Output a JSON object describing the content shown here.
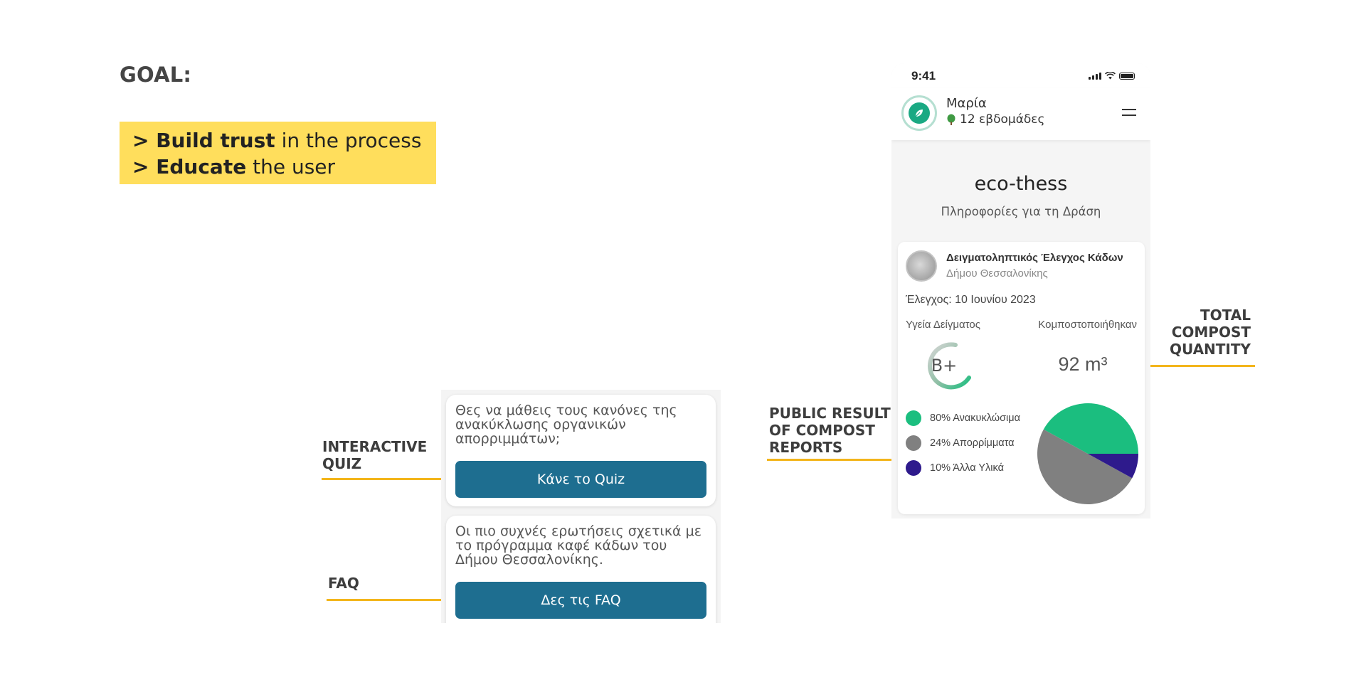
{
  "slide": {
    "goal_title": "GOAL:",
    "goal_lines": [
      {
        "prefix": "> ",
        "bold": "Build trust",
        "rest": " in the process"
      },
      {
        "prefix": "> ",
        "bold": "Educate",
        "rest": " the user"
      }
    ],
    "annotations": {
      "interactive_quiz": "INTERACTIVE\nQUIZ",
      "faq": "FAQ",
      "public_results": "PUBLIC RESULTS\nOF COMPOST\nREPORTS",
      "total_compost": "TOTAL\nCOMPOST\nQUANTITY"
    },
    "accent_color": "#FFDE5C",
    "arrow_color": "#F3B51B"
  },
  "cards": {
    "quiz_text": "Θες να μάθεις τους κανόνες της ανακύκλωσης οργανικών απορριμμάτων;",
    "quiz_button": "Κάνε το Quiz",
    "faq_text": "Οι πιο συχνές ερωτήσεις σχετικά με το πρόγραμμα καφέ κάδων του Δήμου Θεσσαλονίκης.",
    "faq_button": "Δες τις FAQ",
    "button_color": "#1E6E90"
  },
  "phone": {
    "status_time": "9:41",
    "user": {
      "name": "Μαρία",
      "weeks": "12 εβδομάδες",
      "avatar_icon": "leaf-icon",
      "weeks_icon": "tree-icon"
    },
    "menu_icon": "hamburger-menu-icon",
    "app_title": "eco-thess",
    "app_subtitle": "Πληροφορίες για τη Δράση",
    "report": {
      "title": "Δειγματοληπτικός Έλεγχος Κάδων",
      "org": "Δήμου Θεσσαλονίκης",
      "date": "Έλεγχος: 10 Ιουνίου 2023",
      "health_label": "Υγεία Δείγματος",
      "grade": "B+",
      "compost_label": "Κομποστοποιήθηκαν",
      "quantity": "92 m³",
      "legend": [
        {
          "label": "80% Ανακυκλώσιμα",
          "color": "#1BBE7F"
        },
        {
          "label": "24% Απορρίμματα",
          "color": "#808080"
        },
        {
          "label": "10% Άλλα Υλικά",
          "color": "#2E1A8C"
        }
      ]
    }
  },
  "chart_data": {
    "type": "pie",
    "slices": [
      {
        "label": "Ανακυκλώσιμα",
        "value": 80,
        "color": "#1BBE7F"
      },
      {
        "label": "Απορρίμματα",
        "value": 24,
        "color": "#808080"
      },
      {
        "label": "Άλλα Υλικά",
        "value": 10,
        "color": "#2E1A8C"
      }
    ],
    "visual_slices": [
      {
        "label": "Ανακυκλώσιμα",
        "fraction": 0.42,
        "color": "#1BBE7F"
      },
      {
        "label": "Απορρίμματα",
        "fraction": 0.5,
        "color": "#808080"
      },
      {
        "label": "Άλλα Υλικά",
        "fraction": 0.08,
        "color": "#2E1A8C"
      }
    ]
  }
}
